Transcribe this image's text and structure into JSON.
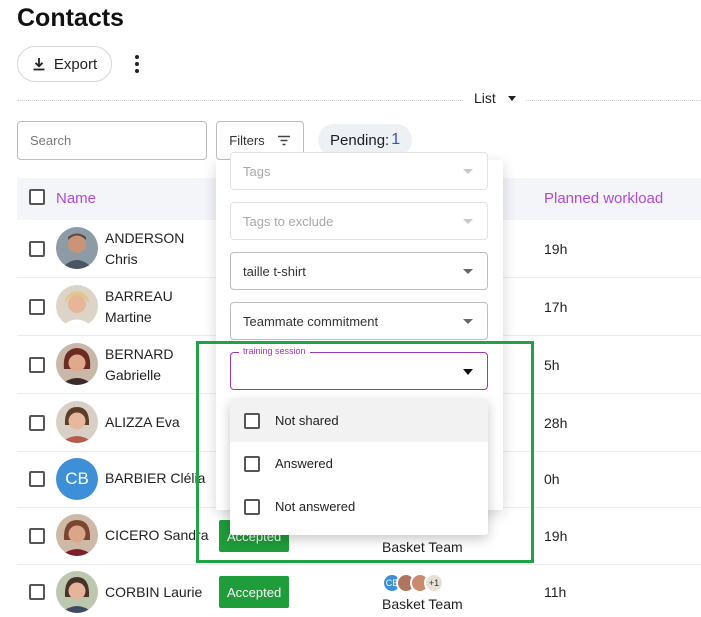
{
  "page": {
    "title": "Contacts"
  },
  "toolbar": {
    "export_label": "Export",
    "more_icon": "more-vertical-icon",
    "view_label": "List",
    "search_placeholder": "Search",
    "filters_label": "Filters",
    "pending_label": "Pending:",
    "pending_count": "1"
  },
  "table": {
    "columns": {
      "name": "Name",
      "workload": "Planned workload"
    },
    "header_color": "#b348d8",
    "rows": [
      {
        "first": "ANDERSON",
        "last": "Chris",
        "workload": "19h",
        "avatar": "photo",
        "status": "",
        "team": ""
      },
      {
        "first": "BARREAU",
        "last": "Martine",
        "workload": "17h",
        "avatar": "photo",
        "status": "",
        "team": ""
      },
      {
        "first": "BERNARD",
        "last": "Gabrielle",
        "workload": "5h",
        "avatar": "photo",
        "status": "",
        "team": ""
      },
      {
        "first": "ALIZZA Eva",
        "last": "",
        "workload": "28h",
        "avatar": "photo",
        "status": "",
        "team": ""
      },
      {
        "first": "BARBIER Clélia",
        "last": "",
        "workload": "0h",
        "avatar": "CB",
        "status": "",
        "team": ""
      },
      {
        "first": "CICERO Sandra",
        "last": "",
        "workload": "19h",
        "avatar": "photo",
        "status": "Accepted",
        "team": "Basket Team"
      },
      {
        "first": "CORBIN Laurie",
        "last": "",
        "workload": "11h",
        "avatar": "photo",
        "status": "Accepted",
        "team": "Basket Team",
        "team_avatars": [
          "CB",
          "",
          "",
          "+1"
        ]
      }
    ]
  },
  "filters_panel": {
    "fields": [
      {
        "label": "Tags",
        "disabled": true
      },
      {
        "label": "Tags to exclude",
        "disabled": true
      },
      {
        "label": "taille t-shirt",
        "disabled": false
      },
      {
        "label": "Teammate commitment",
        "disabled": false
      }
    ],
    "active_field": {
      "label": "training session",
      "value": ""
    },
    "options": [
      {
        "label": "Not shared",
        "checked": false
      },
      {
        "label": "Answered",
        "checked": false
      },
      {
        "label": "Not answered",
        "checked": false
      }
    ]
  },
  "colors": {
    "accent": "#9b37b3",
    "accepted": "#1f9d3a",
    "highlight": "#22a247",
    "initials_avatar": "#3d8fd8"
  }
}
